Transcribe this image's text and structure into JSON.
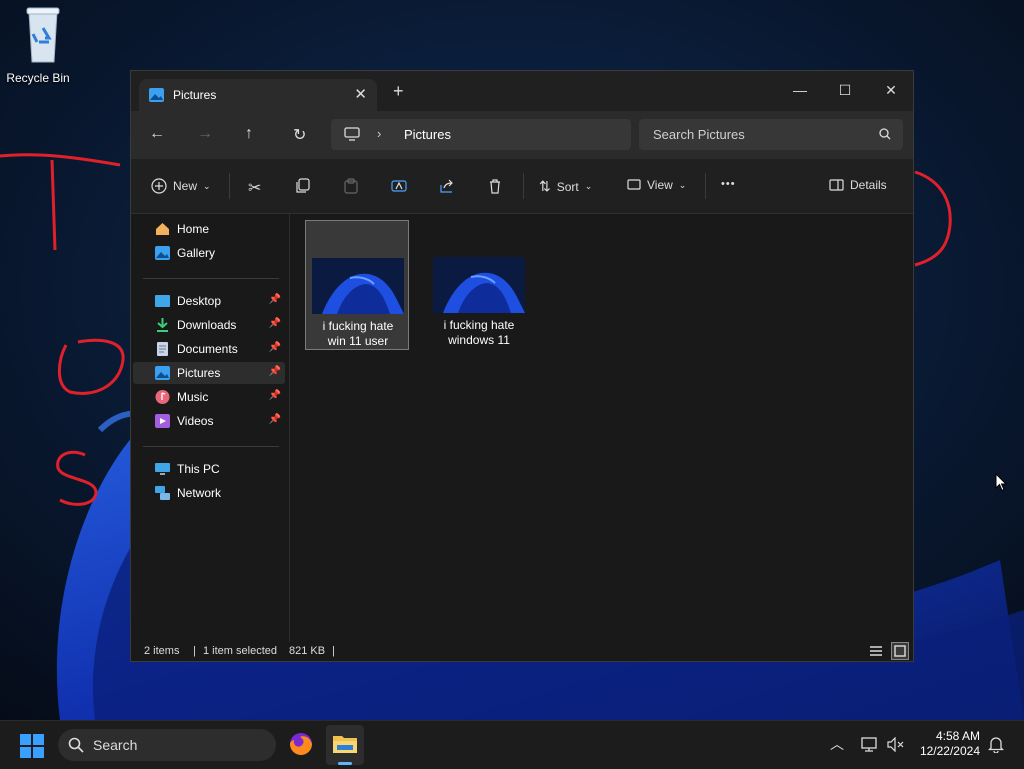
{
  "desktop": {
    "recycle_bin_label": "Recycle Bin"
  },
  "window": {
    "tab_title": "Pictures",
    "new_tab_symbol": "+",
    "minimize_symbol": "—",
    "maximize_symbol": "☐",
    "close_symbol": "✕",
    "address_crumb": "Pictures",
    "search_placeholder": "Search Pictures"
  },
  "toolbar": {
    "new_label": "New",
    "sort_label": "Sort",
    "view_label": "View",
    "more_label": "•••",
    "details_label": "Details"
  },
  "sidebar": {
    "items": [
      {
        "label": "Home",
        "icon": "home-icon"
      },
      {
        "label": "Gallery",
        "icon": "gallery-icon"
      },
      {
        "label": "Desktop",
        "icon": "desktop-folder-icon",
        "pinned": true
      },
      {
        "label": "Downloads",
        "icon": "downloads-icon",
        "pinned": true
      },
      {
        "label": "Documents",
        "icon": "documents-icon",
        "pinned": true
      },
      {
        "label": "Pictures",
        "icon": "pictures-icon",
        "pinned": true,
        "selected": true
      },
      {
        "label": "Music",
        "icon": "music-icon",
        "pinned": true
      },
      {
        "label": "Videos",
        "icon": "videos-icon",
        "pinned": true
      },
      {
        "label": "This PC",
        "icon": "this-pc-icon"
      },
      {
        "label": "Network",
        "icon": "network-icon"
      }
    ]
  },
  "files": [
    {
      "name_line1": "i fucking hate",
      "name_line2": "win 11 user",
      "selected": true
    },
    {
      "name_line1": "i fucking hate",
      "name_line2": "windows 11",
      "selected": false
    }
  ],
  "status": {
    "item_count": "2 items",
    "sep": "|",
    "selection": "1 item selected",
    "size": "821 KB"
  },
  "taskbar": {
    "search_label": "Search",
    "time": "4:58 AM",
    "date": "12/22/2024"
  },
  "colors": {
    "accent": "#0078d4",
    "scribble": "#e0202a",
    "window_bg": "#191919"
  }
}
